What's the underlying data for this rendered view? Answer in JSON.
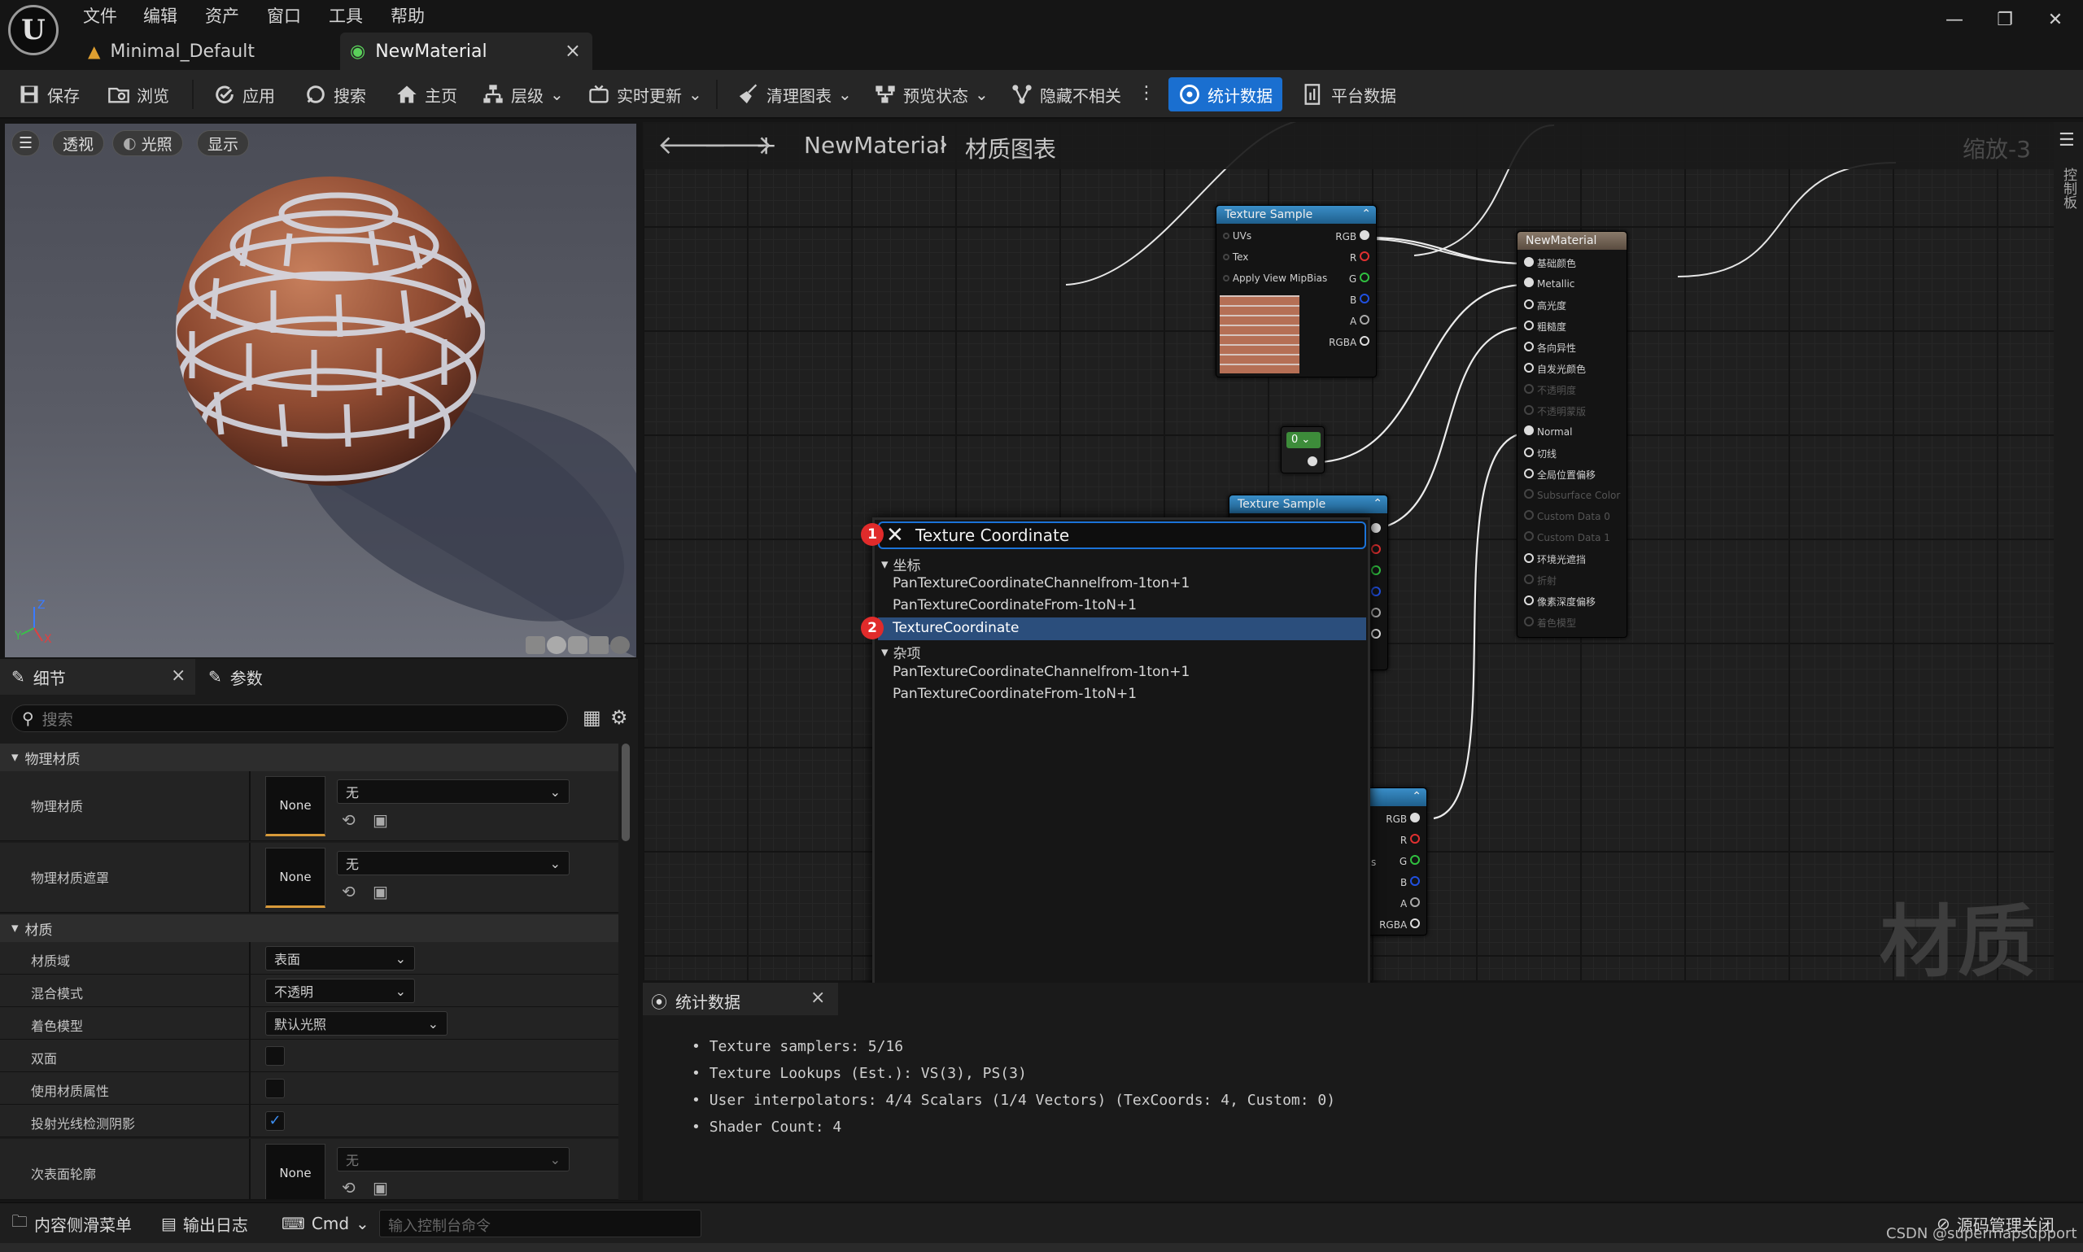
{
  "menu": [
    "文件",
    "编辑",
    "资产",
    "窗口",
    "工具",
    "帮助"
  ],
  "tabs": [
    {
      "label": "Minimal_Default"
    },
    {
      "label": "NewMaterial",
      "close": "×"
    }
  ],
  "window_controls": [
    "—",
    "❐",
    "✕"
  ],
  "toolbar": {
    "save": "保存",
    "browse": "浏览",
    "apply": "应用",
    "search": "搜索",
    "home": "主页",
    "hierarchy": "层级",
    "live_update": "实时更新",
    "clean_graph": "清理图表",
    "preview_state": "预览状态",
    "hide_unrelated": "隐藏不相关",
    "stats": "统计数据",
    "platform_stats": "平台数据"
  },
  "viewport": {
    "perspective": "透视",
    "lit": "光照",
    "show": "显示",
    "axis_z": "Z",
    "axis_y": "Y",
    "axis_x": "X"
  },
  "details": {
    "tab_details": "细节",
    "tab_params": "参数",
    "close": "×",
    "search_placeholder": "搜索",
    "sections": {
      "physical": "物理材质",
      "material": "材质"
    },
    "rows": {
      "phys_mat": "物理材质",
      "phys_mask": "物理材质遮罩",
      "domain": "材质域",
      "blend": "混合模式",
      "shading": "着色模型",
      "two_sided": "双面",
      "use_attrs": "使用材质属性",
      "cast_ray": "投射光线检测阴影",
      "subsurface": "次表面轮廓"
    },
    "values": {
      "none": "None",
      "wu": "无",
      "surface": "表面",
      "opaque": "不透明",
      "default_lit": "默认光照"
    }
  },
  "graph": {
    "breadcrumb_asset": "NewMaterial",
    "breadcrumb_graph": "材质图表",
    "zoom": "缩放-3",
    "watermark": "材质",
    "side_label": "控制板",
    "tex1": {
      "title": "Texture Sample",
      "inputs": [
        "UVs",
        "Tex",
        "Apply View MipBias"
      ],
      "outputs": [
        "RGB",
        "R",
        "G",
        "B",
        "A",
        "RGBA"
      ]
    },
    "const_node": {
      "value": "0"
    },
    "tex2": {
      "title": "Texture Sample"
    },
    "tex3": {
      "outputs": [
        "RGB",
        "R",
        "G",
        "B",
        "A",
        "RGBA"
      ],
      "partial": "s"
    },
    "mat_node": {
      "title": "NewMaterial",
      "pins": [
        "基础颜色",
        "Metallic",
        "高光度",
        "粗糙度",
        "各向异性",
        "自发光颜色",
        "不透明度",
        "不透明蒙版",
        "Normal",
        "切线",
        "全局位置偏移",
        "Subsurface Color",
        "Custom Data 0",
        "Custom Data 1",
        "环境光遮挡",
        "折射",
        "像素深度偏移",
        "着色模型"
      ]
    }
  },
  "search_popup": {
    "query": "Texture Coordinate",
    "categories": [
      {
        "name": "坐标",
        "items": [
          "PanTextureCoordinateChannelfrom-1ton+1",
          "PanTextureCoordinateFrom-1toN+1",
          "TextureCoordinate"
        ]
      },
      {
        "name": "杂项",
        "items": [
          "PanTextureCoordinateChannelfrom-1ton+1",
          "PanTextureCoordinateFrom-1toN+1"
        ]
      }
    ],
    "badge1": "1",
    "badge2": "2"
  },
  "stats": {
    "tab": "统计数据",
    "close": "×",
    "lines": [
      "Texture samplers: 5/16",
      "Texture Lookups (Est.): VS(3), PS(3)",
      "User interpolators: 4/4 Scalars (1/4 Vectors) (TexCoords: 4, Custom: 0)",
      "Shader Count: 4"
    ]
  },
  "bottom": {
    "content_drawer": "内容侧滑菜单",
    "output_log": "输出日志",
    "cmd": "Cmd",
    "console_placeholder": "输入控制台命令",
    "source_control": "源码管理关闭",
    "watermark": "CSDN @supermapsupport"
  }
}
